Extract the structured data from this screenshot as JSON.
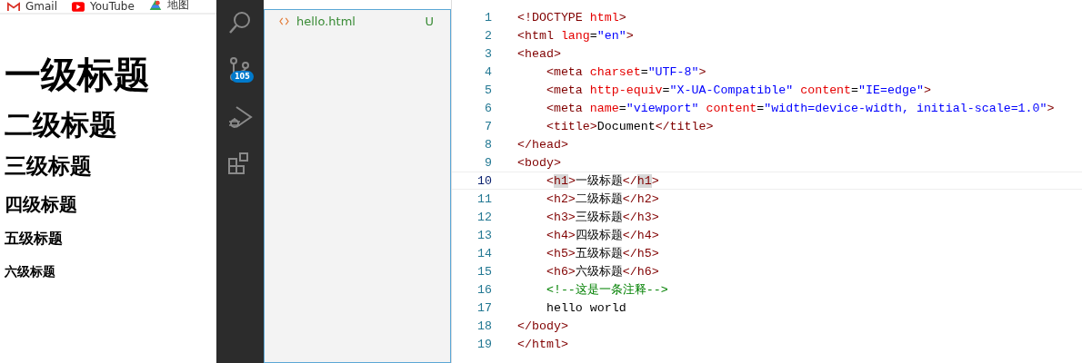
{
  "browser": {
    "bookmarks": [
      {
        "kind": "gmail",
        "label": "Gmail"
      },
      {
        "kind": "youtube",
        "label": "YouTube"
      },
      {
        "kind": "maps",
        "label": "地图"
      }
    ],
    "headings": [
      {
        "kind": "h1",
        "text": "一级标题"
      },
      {
        "kind": "h2",
        "text": "二级标题"
      },
      {
        "kind": "h3",
        "text": "三级标题"
      },
      {
        "kind": "h4",
        "text": "四级标题"
      },
      {
        "kind": "h5",
        "text": "五级标题"
      },
      {
        "kind": "h6",
        "text": "六级标题"
      }
    ]
  },
  "activity_bar": [
    {
      "kind": "search"
    },
    {
      "kind": "source-control",
      "badge": "105"
    },
    {
      "kind": "run-debug"
    },
    {
      "kind": "extensions"
    }
  ],
  "explorer": {
    "files": [
      {
        "name": "hello.html",
        "status": "U",
        "selected": false
      }
    ]
  },
  "editor": {
    "lines": [
      {
        "number": "1",
        "current": false,
        "tokens": [
          {
            "kind": "tag",
            "text": "<!DOCTYPE "
          },
          {
            "kind": "attr",
            "text": "html"
          },
          {
            "kind": "tag",
            "text": ">"
          }
        ]
      },
      {
        "number": "2",
        "current": false,
        "tokens": [
          {
            "kind": "tag",
            "text": "<html "
          },
          {
            "kind": "attr",
            "text": "lang"
          },
          {
            "kind": "plain",
            "text": "="
          },
          {
            "kind": "value",
            "text": "\"en\""
          },
          {
            "kind": "tag",
            "text": ">"
          }
        ]
      },
      {
        "number": "3",
        "current": false,
        "tokens": [
          {
            "kind": "tag",
            "text": "<head>"
          }
        ]
      },
      {
        "number": "4",
        "current": false,
        "tokens": [
          {
            "kind": "tag",
            "text": "    <meta "
          },
          {
            "kind": "attr",
            "text": "charset"
          },
          {
            "kind": "plain",
            "text": "="
          },
          {
            "kind": "value",
            "text": "\"UTF-8\""
          },
          {
            "kind": "tag",
            "text": ">"
          }
        ]
      },
      {
        "number": "5",
        "current": false,
        "tokens": [
          {
            "kind": "tag",
            "text": "    <meta "
          },
          {
            "kind": "attr",
            "text": "http-equiv"
          },
          {
            "kind": "plain",
            "text": "="
          },
          {
            "kind": "value",
            "text": "\"X-UA-Compatible\""
          },
          {
            "kind": "attr",
            "text": " content"
          },
          {
            "kind": "plain",
            "text": "="
          },
          {
            "kind": "value",
            "text": "\"IE=edge\""
          },
          {
            "kind": "tag",
            "text": ">"
          }
        ]
      },
      {
        "number": "6",
        "current": false,
        "tokens": [
          {
            "kind": "tag",
            "text": "    <meta "
          },
          {
            "kind": "attr",
            "text": "name"
          },
          {
            "kind": "plain",
            "text": "="
          },
          {
            "kind": "value",
            "text": "\"viewport\""
          },
          {
            "kind": "attr",
            "text": " content"
          },
          {
            "kind": "plain",
            "text": "="
          },
          {
            "kind": "value",
            "text": "\"width=device-width, initial-scale=1.0\""
          },
          {
            "kind": "tag",
            "text": ">"
          }
        ]
      },
      {
        "number": "7",
        "current": false,
        "tokens": [
          {
            "kind": "tag",
            "text": "    <title>"
          },
          {
            "kind": "plain",
            "text": "Document"
          },
          {
            "kind": "tag",
            "text": "</title>"
          }
        ]
      },
      {
        "number": "8",
        "current": false,
        "tokens": [
          {
            "kind": "tag",
            "text": "</head>"
          }
        ]
      },
      {
        "number": "9",
        "current": false,
        "tokens": [
          {
            "kind": "tag",
            "text": "<body>"
          }
        ]
      },
      {
        "number": "10",
        "current": true,
        "tokens": [
          {
            "kind": "tag",
            "text": "    <"
          },
          {
            "kind": "match",
            "text": "h1"
          },
          {
            "kind": "tag",
            "text": ">"
          },
          {
            "kind": "plain",
            "text": "一级标题"
          },
          {
            "kind": "tag",
            "text": "</"
          },
          {
            "kind": "match",
            "text": "h1"
          },
          {
            "kind": "tag",
            "text": ">"
          }
        ]
      },
      {
        "number": "11",
        "current": false,
        "tokens": [
          {
            "kind": "tag",
            "text": "    <h2>"
          },
          {
            "kind": "plain",
            "text": "二级标题"
          },
          {
            "kind": "tag",
            "text": "</h2>"
          }
        ]
      },
      {
        "number": "12",
        "current": false,
        "tokens": [
          {
            "kind": "tag",
            "text": "    <h3>"
          },
          {
            "kind": "plain",
            "text": "三级标题"
          },
          {
            "kind": "tag",
            "text": "</h3>"
          }
        ]
      },
      {
        "number": "13",
        "current": false,
        "tokens": [
          {
            "kind": "tag",
            "text": "    <h4>"
          },
          {
            "kind": "plain",
            "text": "四级标题"
          },
          {
            "kind": "tag",
            "text": "</h4>"
          }
        ]
      },
      {
        "number": "14",
        "current": false,
        "tokens": [
          {
            "kind": "tag",
            "text": "    <h5>"
          },
          {
            "kind": "plain",
            "text": "五级标题"
          },
          {
            "kind": "tag",
            "text": "</h5>"
          }
        ]
      },
      {
        "number": "15",
        "current": false,
        "tokens": [
          {
            "kind": "tag",
            "text": "    <h6>"
          },
          {
            "kind": "plain",
            "text": "六级标题"
          },
          {
            "kind": "tag",
            "text": "</h6>"
          }
        ]
      },
      {
        "number": "16",
        "current": false,
        "tokens": [
          {
            "kind": "comment",
            "text": "    <!--这是一条注释-->"
          }
        ]
      },
      {
        "number": "17",
        "current": false,
        "tokens": [
          {
            "kind": "plain",
            "text": "    hello world"
          }
        ]
      },
      {
        "number": "18",
        "current": false,
        "tokens": [
          {
            "kind": "tag",
            "text": "</body>"
          }
        ]
      },
      {
        "number": "19",
        "current": false,
        "tokens": [
          {
            "kind": "tag",
            "text": "</html>"
          }
        ]
      }
    ]
  }
}
